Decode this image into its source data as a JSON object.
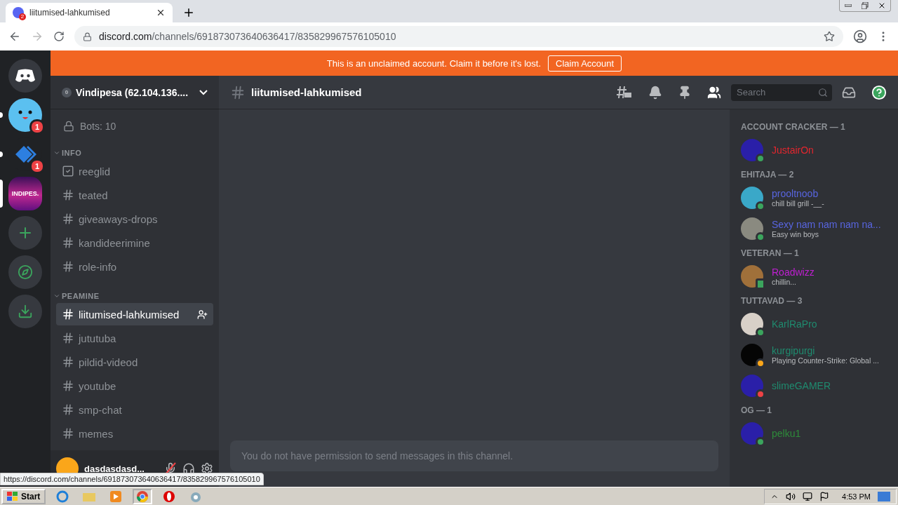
{
  "browser": {
    "tab_title": "liitumised-lahkumised",
    "tab_badge": "2",
    "url_host": "discord.com",
    "url_path": "/channels/691873073640636417/835829967576105010"
  },
  "banner": {
    "text": "This is an unclaimed account. Claim it before it's lost.",
    "button": "Claim Account"
  },
  "servers": [
    {
      "kind": "home",
      "selected": false
    },
    {
      "kind": "face",
      "badge": "1",
      "unread": true,
      "selected": false
    },
    {
      "kind": "diamond",
      "badge": "1",
      "unread": true,
      "selected": false
    },
    {
      "kind": "banner",
      "label": "INDIPES.",
      "selected": true
    },
    {
      "kind": "add",
      "selected": false
    },
    {
      "kind": "explore",
      "selected": false
    },
    {
      "kind": "download",
      "selected": false
    }
  ],
  "server": {
    "boost": "0",
    "name": "Vindipesa (62.104.136....",
    "bots": "Bots: 10"
  },
  "categories": [
    {
      "name": "INFO",
      "channels": [
        {
          "name": "reeglid",
          "kind": "rules",
          "selected": false
        },
        {
          "name": "teated",
          "kind": "text",
          "selected": false
        },
        {
          "name": "giveaways-drops",
          "kind": "text",
          "selected": false
        },
        {
          "name": "kandideerimine",
          "kind": "text",
          "selected": false
        },
        {
          "name": "role-info",
          "kind": "text",
          "selected": false
        }
      ]
    },
    {
      "name": "PEAMINE",
      "channels": [
        {
          "name": "liitumised-lahkumised",
          "kind": "text",
          "selected": true
        },
        {
          "name": "jututuba",
          "kind": "text",
          "selected": false
        },
        {
          "name": "pildid-videod",
          "kind": "text",
          "selected": false
        },
        {
          "name": "youtube",
          "kind": "text",
          "selected": false
        },
        {
          "name": "smp-chat",
          "kind": "text",
          "selected": false
        },
        {
          "name": "memes",
          "kind": "text",
          "selected": false
        }
      ]
    }
  ],
  "user": {
    "name": "dasdasdasd...",
    "muted": true
  },
  "channel": {
    "name": "liitumised-lahkumised",
    "search_placeholder": "Search",
    "input_placeholder": "You do not have permission to send messages in this channel."
  },
  "member_groups": [
    {
      "title": "ACCOUNT CRACKER — 1",
      "members": [
        {
          "name": "JustairOn",
          "color": "#e3262e",
          "presence_dot": {
            "kind": "circle",
            "color": "#3ba55d"
          }
        }
      ]
    },
    {
      "title": "EHITAJA — 2",
      "members": [
        {
          "name": "prooltnoob",
          "color": "#5865e0",
          "presence_dot": {
            "kind": "circle",
            "color": "#3ba55d"
          },
          "status": "chill bill grill -__-"
        },
        {
          "name": "Sexy nam nam nam na...",
          "color": "#5865e0",
          "presence_dot": {
            "kind": "circle",
            "color": "#3ba55d"
          },
          "status": "Easy win boys"
        }
      ]
    },
    {
      "title": "VETERAN — 1",
      "members": [
        {
          "name": "Roadwizz",
          "color": "#c01fd2",
          "presence_dot": {
            "kind": "phone",
            "color": "#3ba55d"
          },
          "status": "chillin..."
        }
      ]
    },
    {
      "title": "TUTTAVAD — 3",
      "members": [
        {
          "name": "KarlRaPro",
          "color": "#1f8b6f",
          "presence_dot": {
            "kind": "circle",
            "color": "#3ba55d"
          }
        },
        {
          "name": "kurgipurgi",
          "color": "#1f8b6f",
          "presence_dot": {
            "kind": "circle",
            "color": "#faa61a"
          },
          "status": "Playing Counter-Strike: Global ..."
        },
        {
          "name": "slimeGAMER",
          "color": "#1f8b6f",
          "presence_dot": {
            "kind": "circle",
            "color": "#ed4245"
          }
        }
      ]
    },
    {
      "title": "OG — 1",
      "members": [
        {
          "name": "pelku1",
          "color": "#2e8b3a",
          "presence_dot": {
            "kind": "circle",
            "color": "#3ba55d"
          }
        }
      ]
    }
  ],
  "status_url": "https://discord.com/channels/691873073640636417/835829967576105010",
  "taskbar": {
    "start": "Start",
    "time": "4:53 PM"
  }
}
